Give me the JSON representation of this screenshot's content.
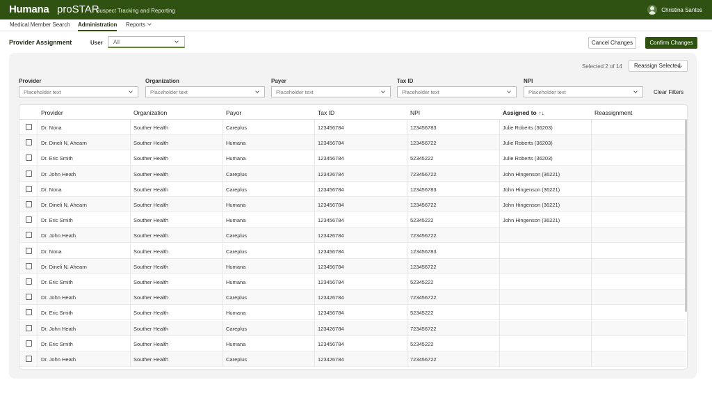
{
  "header": {
    "logo": "Humana",
    "product": "proSTAR",
    "subtitle": "Suspect Tracking and Reporting",
    "user_name": "Christina Santos",
    "user_icon": "avatar-icon"
  },
  "nav": {
    "items": [
      {
        "label": "Medical Member Search"
      },
      {
        "label": "Administration"
      },
      {
        "label": "Reports"
      }
    ]
  },
  "page": {
    "title": "Provider Assignment",
    "user_label": "User",
    "user_value": "All",
    "cancel_label": "Cancel Changes",
    "confirm_label": "Confirm Changes"
  },
  "toolbar": {
    "selected_text": "Selected 2 of 14",
    "reassign_label": "Reassign Selected",
    "clear_filters": "Clear Filters"
  },
  "filters": [
    {
      "label": "Provider",
      "placeholder": "Placeholder text"
    },
    {
      "label": "Organization",
      "placeholder": "Placeholder text"
    },
    {
      "label": "Payer",
      "placeholder": "Placeholder text"
    },
    {
      "label": "Tax ID",
      "placeholder": "Placeholder text"
    },
    {
      "label": "NPI",
      "placeholder": "Placeholder text"
    }
  ],
  "table": {
    "columns": [
      "Provider",
      "Organization",
      "Payor",
      "Tax ID",
      "NPI",
      "Assigned to",
      "Reassignment"
    ],
    "sort_icon": "↑↓",
    "rows": [
      {
        "provider": "Dr. Nona",
        "org": "Souther Health",
        "payor": "Careplus",
        "tax": "123456784",
        "npi": "123456783",
        "assigned": "Julie Roberts (36203)"
      },
      {
        "provider": "Dr. Dineli N, Ahearn",
        "org": "Souther Health",
        "payor": "Humana",
        "tax": "123456784",
        "npi": "123456722",
        "assigned": "Julie Roberts (36203)"
      },
      {
        "provider": "Dr. Eric Smith",
        "org": "Souther Health",
        "payor": "Humana",
        "tax": "123456784",
        "npi": "52345222",
        "assigned": "Julie Roberts (36203)"
      },
      {
        "provider": "Dr. John Heath",
        "org": "Souther Health",
        "payor": "Careplus",
        "tax": "123426784",
        "npi": "723456722",
        "assigned": "John Hingenson (36221)"
      },
      {
        "provider": "Dr. Nona",
        "org": "Souther Health",
        "payor": "Careplus",
        "tax": "123456784",
        "npi": "123456783",
        "assigned": "John Hingenson (36221)"
      },
      {
        "provider": "Dr. Dineli N, Ahearn",
        "org": "Souther Health",
        "payor": "Humana",
        "tax": "123456784",
        "npi": "123456722",
        "assigned": "John Hingenson (36221)"
      },
      {
        "provider": "Dr. Eric Smith",
        "org": "Souther Health",
        "payor": "Humana",
        "tax": "123456784",
        "npi": "52345222",
        "assigned": "John Hingenson (36221)"
      },
      {
        "provider": "Dr. John Heath",
        "org": "Souther Health",
        "payor": "Careplus",
        "tax": "123426784",
        "npi": "723456722",
        "assigned": ""
      },
      {
        "provider": "Dr. Nona",
        "org": "Souther Health",
        "payor": "Careplus",
        "tax": "123456784",
        "npi": "123456783",
        "assigned": ""
      },
      {
        "provider": "Dr. Dineli N, Ahearn",
        "org": "Souther Health",
        "payor": "Humana",
        "tax": "123456784",
        "npi": "123456722",
        "assigned": ""
      },
      {
        "provider": "Dr. Eric Smith",
        "org": "Souther Health",
        "payor": "Humana",
        "tax": "123456784",
        "npi": "52345222",
        "assigned": ""
      },
      {
        "provider": "Dr. John Heath",
        "org": "Souther Health",
        "payor": "Careplus",
        "tax": "123426784",
        "npi": "723456722",
        "assigned": ""
      },
      {
        "provider": "Dr. Eric Smith",
        "org": "Souther Health",
        "payor": "Humana",
        "tax": "123456784",
        "npi": "52345222",
        "assigned": ""
      },
      {
        "provider": "Dr. John Heath",
        "org": "Souther Health",
        "payor": "Careplus",
        "tax": "123426784",
        "npi": "723456722",
        "assigned": ""
      },
      {
        "provider": "Dr. Eric Smith",
        "org": "Souther Health",
        "payor": "Humana",
        "tax": "123456784",
        "npi": "52345222",
        "assigned": ""
      },
      {
        "provider": "Dr. John Heath",
        "org": "Souther Health",
        "payor": "Careplus",
        "tax": "123426784",
        "npi": "723456722",
        "assigned": ""
      }
    ]
  },
  "colors": {
    "brand_green": "#2f5213",
    "accent_green": "#5d8a2a"
  }
}
